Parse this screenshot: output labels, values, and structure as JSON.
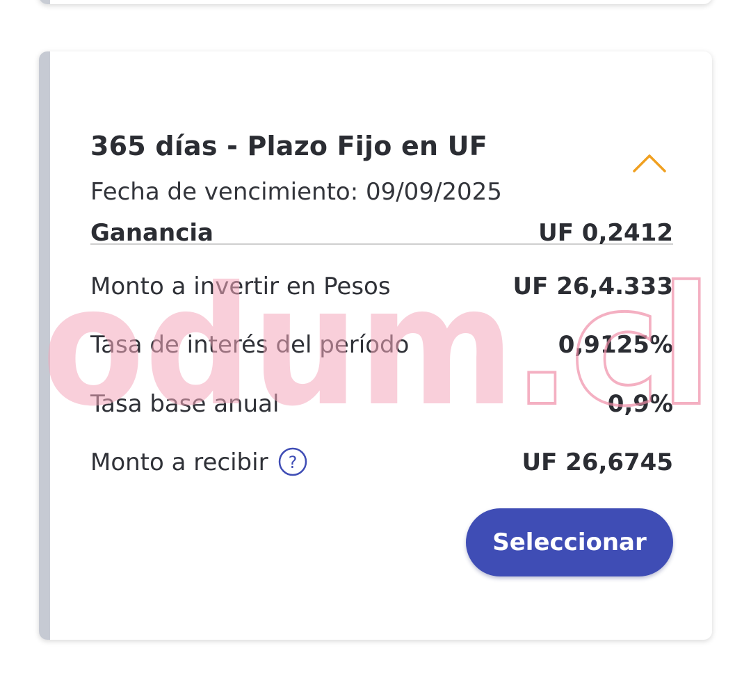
{
  "card": {
    "title": "365 días - Plazo Fijo en UF",
    "maturity": "Fecha de vencimiento: 09/09/2025",
    "rows": [
      {
        "label": "Ganancia",
        "value": "UF 0,2412"
      },
      {
        "label": "Monto a invertir en Pesos",
        "value": "UF 26,4.333"
      },
      {
        "label": "Tasa de interés del período",
        "value": "0,9125%"
      },
      {
        "label": "Tasa base anual",
        "value": "0,9%"
      },
      {
        "label": "Monto a recibir",
        "value": "UF 26,6745"
      }
    ],
    "help_glyph": "?",
    "select_label": "Seleccionar",
    "expanded": true
  },
  "watermark": {
    "text": "odum",
    "suffix": ".cl"
  },
  "colors": {
    "primary_button": "#3f4db5",
    "chevron": "#f0a020",
    "accent_bar": "#c6cad3",
    "help_icon": "#3f4db5",
    "watermark": "#f08fa8"
  },
  "icons": {
    "collapse": "chevron-up-icon",
    "help": "question-circle-icon"
  }
}
